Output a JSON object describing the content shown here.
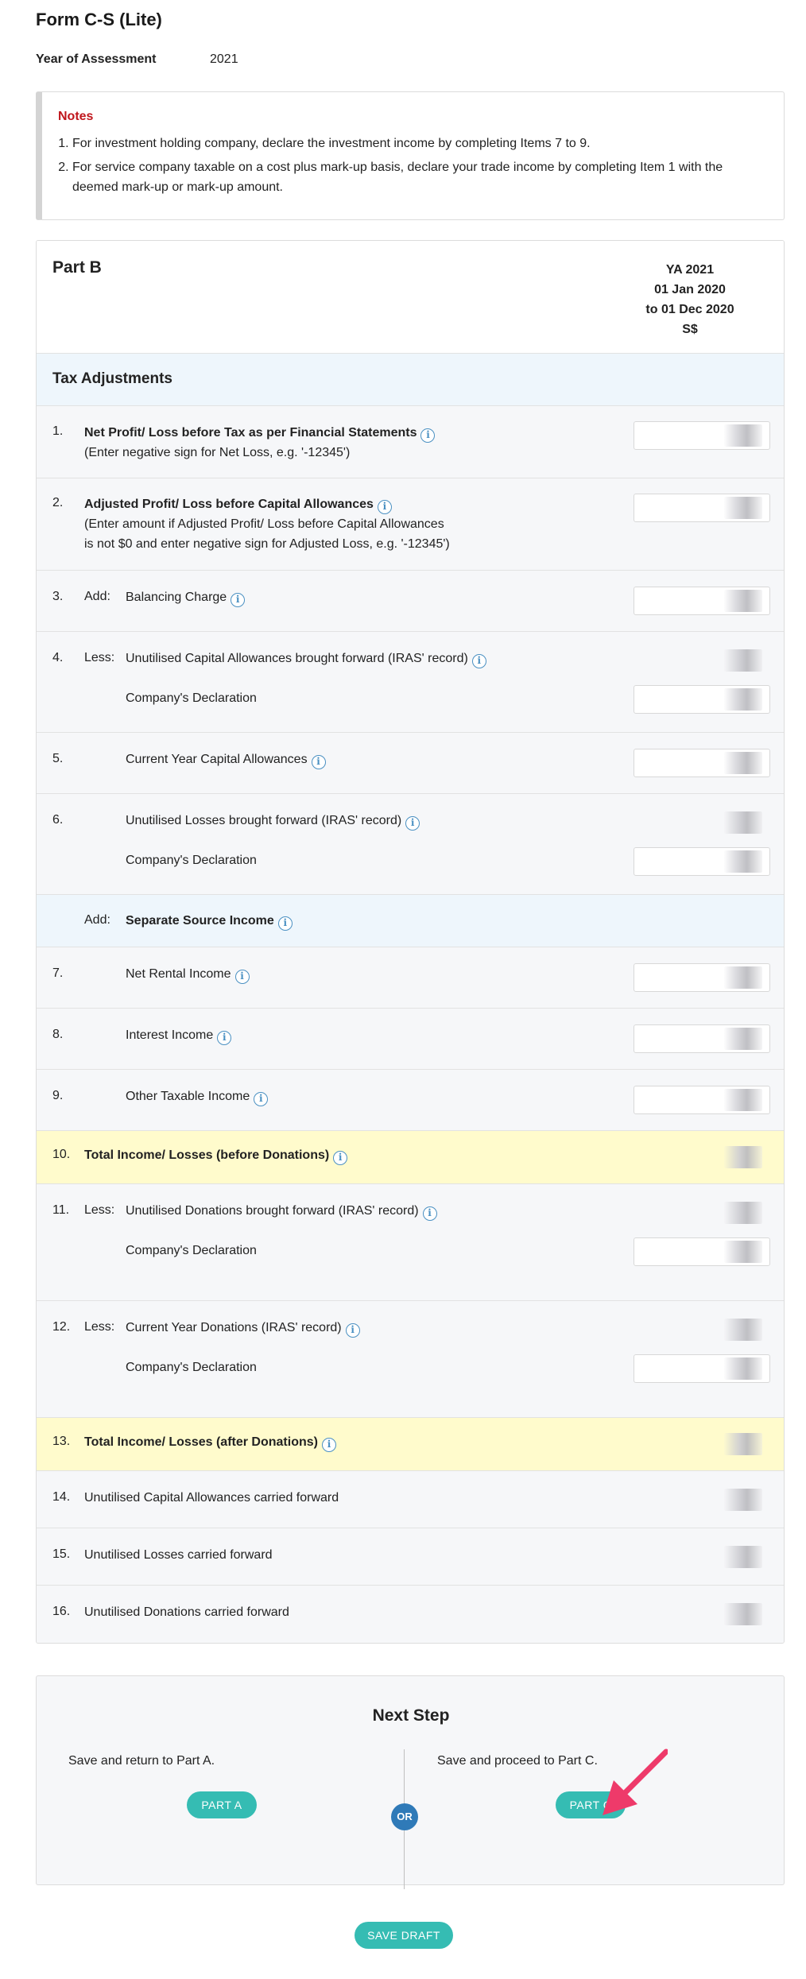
{
  "form": {
    "title": "Form C-S (Lite)",
    "ya_label": "Year of Assessment",
    "ya_value": "2021"
  },
  "notes": {
    "title": "Notes",
    "items": [
      "For investment holding company, declare the investment income by completing Items 7 to 9.",
      "For service company taxable on a cost plus mark-up basis, declare your trade income by completing Item 1 with the deemed mark-up or mark-up amount."
    ]
  },
  "partb": {
    "title": "Part B",
    "col_head": [
      "YA 2021",
      "01 Jan 2020",
      "to 01 Dec 2020",
      "S$"
    ],
    "section_tax": "Tax Adjustments",
    "rows": {
      "r1": {
        "num": "1.",
        "label": "Net Profit/ Loss before Tax as per Financial Statements",
        "note": "(Enter negative sign for Net Loss, e.g. '-12345')"
      },
      "r2": {
        "num": "2.",
        "label": "Adjusted Profit/ Loss before Capital Allowances",
        "note1": "(Enter amount if Adjusted Profit/ Loss before Capital Allowances",
        "note2": "is not $0 and enter negative sign for Adjusted Loss, e.g. '-12345')"
      },
      "r3": {
        "num": "3.",
        "op": "Add:",
        "label": "Balancing Charge"
      },
      "r4": {
        "num": "4.",
        "op": "Less:",
        "label": "Unutilised Capital Allowances brought forward (IRAS' record)",
        "decl": "Company's Declaration"
      },
      "r5": {
        "num": "5.",
        "label": "Current Year Capital Allowances"
      },
      "r6": {
        "num": "6.",
        "label": "Unutilised Losses brought forward (IRAS' record)",
        "decl": "Company's Declaration"
      },
      "ssi": {
        "op": "Add:",
        "label": "Separate Source Income"
      },
      "r7": {
        "num": "7.",
        "label": "Net Rental Income"
      },
      "r8": {
        "num": "8.",
        "label": "Interest Income"
      },
      "r9": {
        "num": "9.",
        "label": "Other Taxable Income"
      },
      "r10": {
        "num": "10.",
        "label": "Total Income/ Losses (before Donations)"
      },
      "r11": {
        "num": "11.",
        "op": "Less:",
        "label": "Unutilised Donations brought forward (IRAS' record)",
        "decl": "Company's Declaration"
      },
      "r12": {
        "num": "12.",
        "op": "Less:",
        "label": "Current Year Donations (IRAS' record)",
        "decl": "Company's Declaration"
      },
      "r13": {
        "num": "13.",
        "label": "Total Income/ Losses (after Donations)"
      },
      "r14": {
        "num": "14.",
        "label": "Unutilised Capital Allowances carried forward"
      },
      "r15": {
        "num": "15.",
        "label": "Unutilised Losses carried forward"
      },
      "r16": {
        "num": "16.",
        "label": "Unutilised Donations carried forward"
      }
    }
  },
  "next": {
    "title": "Next Step",
    "left_text": "Save and return to Part A.",
    "right_text": "Save and proceed to Part C.",
    "part_a": "PART A",
    "part_c": "PART C",
    "or": "OR",
    "save_draft": "SAVE DRAFT"
  },
  "colors": {
    "accent": "#35bcb3",
    "notes_title": "#c0161c",
    "section_bg": "#eef6fc",
    "total_bg": "#fffbcc",
    "or_badge": "#2f7ab8",
    "arrow": "#ee3a6a"
  }
}
